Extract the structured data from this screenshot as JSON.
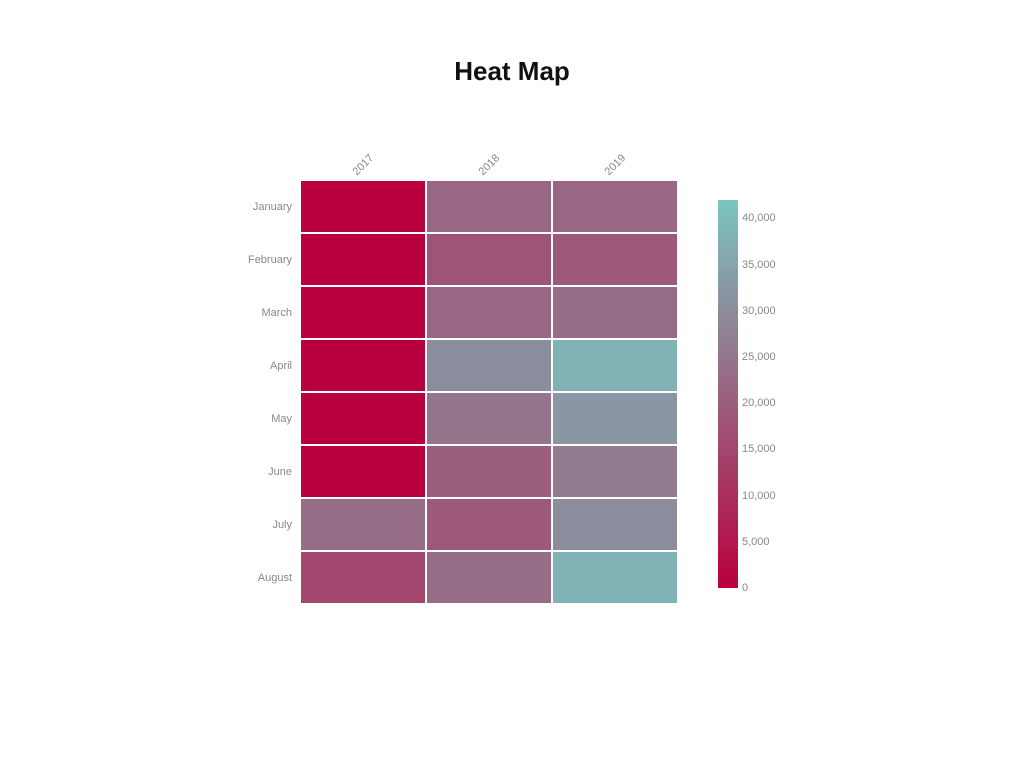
{
  "title": "Heat Map",
  "chart_data": {
    "type": "heatmap",
    "x": [
      "2017",
      "2018",
      "2019"
    ],
    "y": [
      "January",
      "February",
      "March",
      "April",
      "May",
      "June",
      "July",
      "August"
    ],
    "values": [
      [
        0,
        22000,
        22000
      ],
      [
        0,
        18000,
        19000
      ],
      [
        0,
        22000,
        23000
      ],
      [
        0,
        30000,
        38000
      ],
      [
        0,
        25000,
        32000
      ],
      [
        0,
        20000,
        26000
      ],
      [
        23000,
        19000,
        30000
      ],
      [
        15000,
        23000,
        38000
      ]
    ],
    "color_scale": {
      "min": 0,
      "max": 42000,
      "low_color": "#b8003e",
      "high_color": "#7bc5c1"
    },
    "legend_ticks": [
      0,
      5000,
      10000,
      15000,
      20000,
      25000,
      30000,
      35000,
      40000
    ],
    "legend_labels": [
      "0",
      "5,000",
      "10,000",
      "15,000",
      "20,000",
      "25,000",
      "30,000",
      "35,000",
      "40,000"
    ]
  }
}
